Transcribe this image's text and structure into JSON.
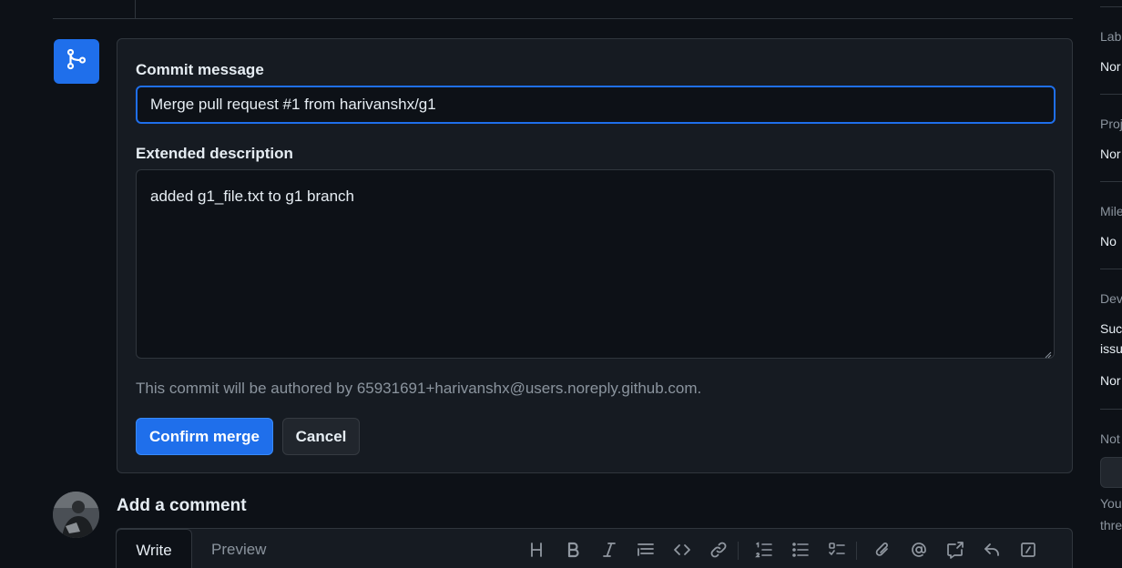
{
  "merge": {
    "commit_label": "Commit message",
    "commit_value": "Merge pull request #1 from harivanshx/g1",
    "extended_label": "Extended description",
    "extended_value": "added g1_file.txt to g1 branch",
    "author_note": "This commit will be authored by 65931691+harivanshx@users.noreply.github.com.",
    "confirm_label": "Confirm merge",
    "cancel_label": "Cancel"
  },
  "comment": {
    "heading": "Add a comment",
    "tabs": [
      {
        "label": "Write",
        "active": true
      },
      {
        "label": "Preview",
        "active": false
      }
    ],
    "toolbar": [
      "heading-icon",
      "bold-icon",
      "italic-icon",
      "quote-icon",
      "code-icon",
      "link-icon",
      "numbered-list-icon",
      "unordered-list-icon",
      "task-list-icon",
      "attach-icon",
      "mention-icon",
      "cross-reference-icon",
      "saved-replies-icon",
      "slash-commands-icon"
    ]
  },
  "sidebar": {
    "sections": [
      {
        "heading": "Lab",
        "values": [
          "Nor"
        ]
      },
      {
        "heading": "Proj",
        "values": [
          "Nor"
        ]
      },
      {
        "heading": "Mile",
        "values": [
          "No"
        ]
      },
      {
        "heading": "Dev",
        "values": [
          "Suc",
          "issu",
          "Nor"
        ]
      },
      {
        "heading": "Not",
        "values": [
          "You",
          "thre"
        ]
      }
    ]
  },
  "colors": {
    "background": "#0d1117",
    "panel": "#161b22",
    "border": "#30363d",
    "accent": "#1f6feb",
    "muted_text": "#8b949e"
  }
}
